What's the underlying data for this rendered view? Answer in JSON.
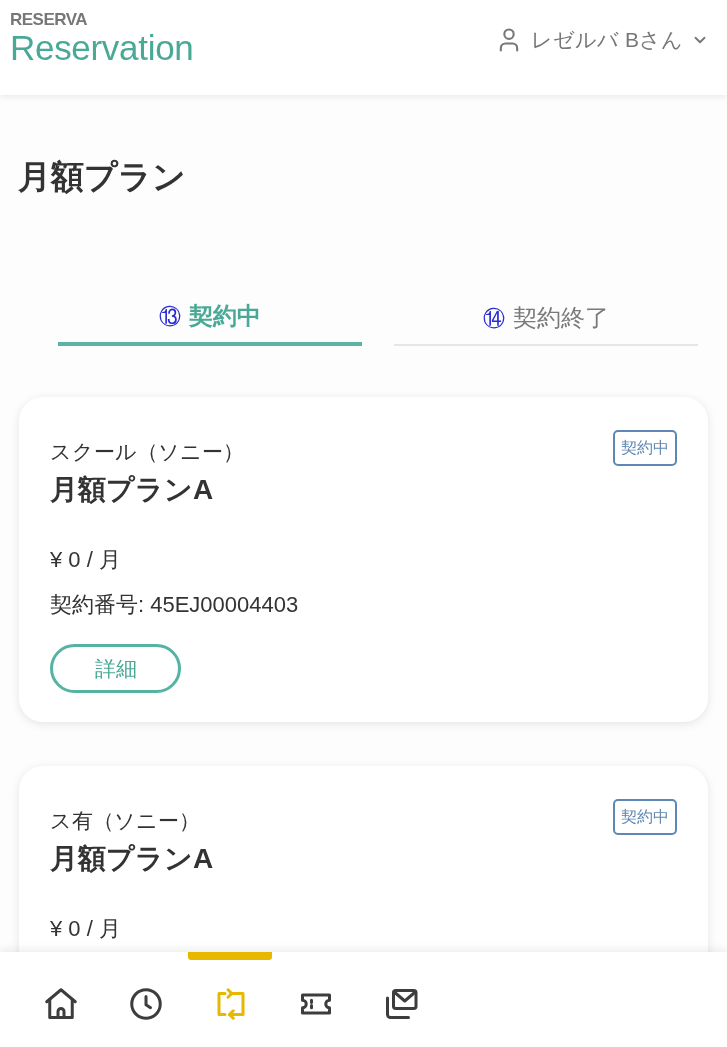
{
  "header": {
    "logo": {
      "small": "RESERVA",
      "large": "Reservation"
    },
    "user": {
      "name": "レゼルバ Bさん"
    }
  },
  "page_title": "月額プラン",
  "tabs": [
    {
      "number": "⑬",
      "label": "契約中",
      "selected": true
    },
    {
      "number": "⑭",
      "label": "契約終了",
      "selected": false
    }
  ],
  "plans": [
    {
      "provider": "スクール（ソニー）",
      "name": "月額プランA",
      "status": "契約中",
      "price": "¥ 0 / 月",
      "contract_number": "契約番号: 45EJ00004403",
      "button": "詳細"
    },
    {
      "provider": "ス有（ソニー）",
      "name": "月額プランA",
      "status": "契約中",
      "price": "¥ 0 / 月"
    }
  ],
  "bottom_nav": [
    {
      "kind": "home",
      "selected": false
    },
    {
      "kind": "history",
      "selected": false
    },
    {
      "kind": "repeat",
      "selected": true
    },
    {
      "kind": "ticket",
      "selected": false
    },
    {
      "kind": "mail",
      "selected": false
    }
  ]
}
